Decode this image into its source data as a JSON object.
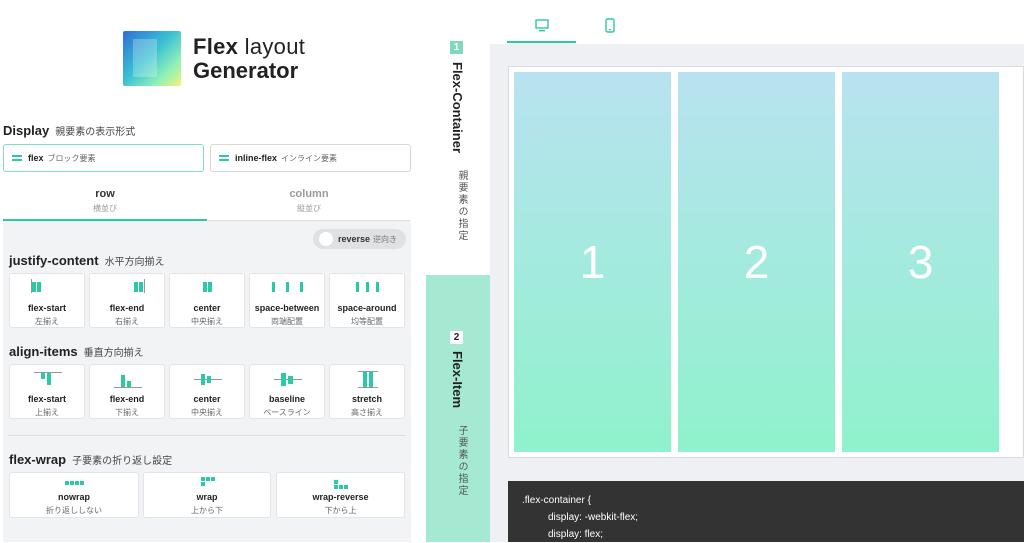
{
  "logo": {
    "line1_bold": "Flex",
    "line1_rest": " layout",
    "line2": "Generator"
  },
  "display": {
    "title": "Display",
    "subtitle": "親要素の表示形式",
    "options": [
      {
        "name": "flex",
        "desc": "ブロック要素",
        "selected": true
      },
      {
        "name": "inline-flex",
        "desc": "インライン要素",
        "selected": false
      }
    ]
  },
  "direction": {
    "tabs": [
      {
        "name": "row",
        "desc": "横並び",
        "selected": true
      },
      {
        "name": "column",
        "desc": "縦並び",
        "selected": false
      }
    ],
    "reverse": {
      "name": "reverse",
      "desc": "逆向き",
      "checked": false
    }
  },
  "justify": {
    "title": "justify-content",
    "subtitle": "水平方向揃え",
    "options": [
      {
        "name": "flex-start",
        "desc": "左揃え"
      },
      {
        "name": "flex-end",
        "desc": "右揃え"
      },
      {
        "name": "center",
        "desc": "中央揃え"
      },
      {
        "name": "space-between",
        "desc": "両端配置"
      },
      {
        "name": "space-around",
        "desc": "均等配置"
      }
    ]
  },
  "align": {
    "title": "align-items",
    "subtitle": "垂直方向揃え",
    "options": [
      {
        "name": "flex-start",
        "desc": "上揃え"
      },
      {
        "name": "flex-end",
        "desc": "下揃え"
      },
      {
        "name": "center",
        "desc": "中央揃え"
      },
      {
        "name": "baseline",
        "desc": "ベースライン"
      },
      {
        "name": "stretch",
        "desc": "高さ揃え"
      }
    ]
  },
  "wrap": {
    "title": "flex-wrap",
    "subtitle": "子要素の折り返し設定",
    "options": [
      {
        "name": "nowrap",
        "desc": "折り返ししない"
      },
      {
        "name": "wrap",
        "desc": "上から下"
      },
      {
        "name": "wrap-reverse",
        "desc": "下から上"
      }
    ]
  },
  "vtabs": [
    {
      "num": "1",
      "label": "Flex-Container",
      "sub": "親要素の指定",
      "active": true
    },
    {
      "num": "2",
      "label": "Flex-Item",
      "sub": "子要素の指定",
      "active": false
    }
  ],
  "preview": {
    "devices": [
      {
        "icon": "desktop-icon",
        "active": true
      },
      {
        "icon": "mobile-icon",
        "active": false
      }
    ],
    "items": [
      "1",
      "2",
      "3"
    ]
  },
  "code": {
    "selector": ".flex-container {",
    "lines": [
      "display: -webkit-flex;",
      "display: flex;"
    ]
  },
  "colors": {
    "accent": "#2bc9a6",
    "item_top": "#b8e2f0",
    "item_bottom": "#8ff2cc",
    "code_bg": "#333333"
  }
}
